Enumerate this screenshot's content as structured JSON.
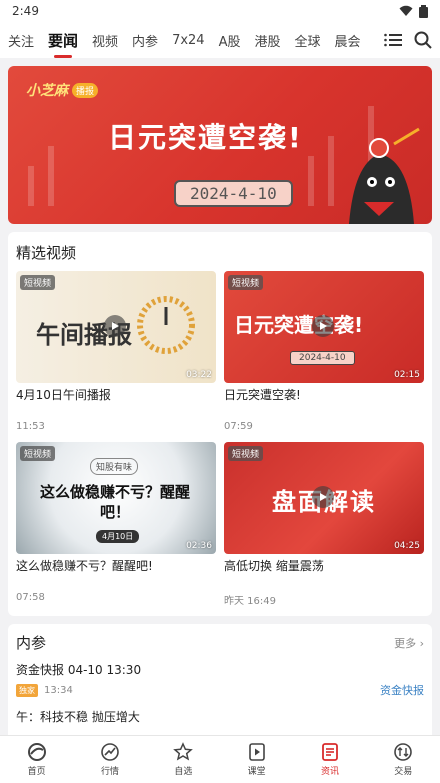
{
  "status_bar": {
    "time": "2:49"
  },
  "tabs": [
    {
      "label": "关注",
      "active": false
    },
    {
      "label": "要闻",
      "active": true
    },
    {
      "label": "视频",
      "active": false
    },
    {
      "label": "内参",
      "active": false
    },
    {
      "label": "7x24",
      "active": false
    },
    {
      "label": "A股",
      "active": false
    },
    {
      "label": "港股",
      "active": false
    },
    {
      "label": "全球",
      "active": false
    },
    {
      "label": "晨会",
      "active": false
    }
  ],
  "banner": {
    "brand": "小芝麻",
    "brand_tag": "播报",
    "title": "日元突遭空袭!",
    "date": "2024-4-10"
  },
  "videos_section": {
    "title": "精选视频",
    "items": [
      {
        "tag": "短视频",
        "thumb_text": "午间播报",
        "duration": "03:22",
        "title": "4月10日午间播报",
        "time": "11:53"
      },
      {
        "tag": "短视频",
        "thumb_text": "日元突遭空袭!",
        "thumb_date": "2024-4-10",
        "duration": "02:15",
        "title": "日元突遭空袭!",
        "time": "07:59"
      },
      {
        "tag": "短视频",
        "thumb_text": "这么做稳赚不亏？醒醒吧！",
        "thumb_sub": "知股有味",
        "thumb_date": "4月10日",
        "duration": "02:36",
        "title": "这么做稳赚不亏？醒醒吧!",
        "time": "07:58"
      },
      {
        "tag": "短视频",
        "thumb_text": "盘面解读",
        "duration": "04:25",
        "title": "高低切换 缩量震荡",
        "time": "昨天 16:49"
      }
    ]
  },
  "neican": {
    "title": "内参",
    "more": "更多",
    "items": [
      {
        "title": "资金快报 04-10 13:30",
        "badge": "独家",
        "time": "13:34",
        "source": "资金快报"
      },
      {
        "title": "午：科技不稳 抛压增大"
      }
    ]
  },
  "bottom_nav": [
    {
      "label": "首页",
      "icon": "home-icon",
      "active": false
    },
    {
      "label": "行情",
      "icon": "market-icon",
      "active": false
    },
    {
      "label": "自选",
      "icon": "star-icon",
      "active": false
    },
    {
      "label": "课堂",
      "icon": "play-icon",
      "active": false
    },
    {
      "label": "资讯",
      "icon": "news-icon",
      "active": true
    },
    {
      "label": "交易",
      "icon": "trade-icon",
      "active": false
    }
  ],
  "colors": {
    "accent": "#d92b2b",
    "link": "#3b82c4",
    "badge": "#f2a53a"
  }
}
